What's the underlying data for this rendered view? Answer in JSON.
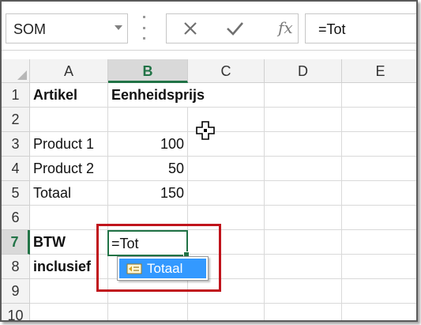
{
  "formula_bar": {
    "name_box": "SOM",
    "cancel_icon": "close-icon",
    "enter_icon": "checkmark-icon",
    "function_label": "fx",
    "formula": "=Tot"
  },
  "columns": [
    "A",
    "B",
    "C",
    "D",
    "E"
  ],
  "selected_column": "B",
  "rows": [
    "1",
    "2",
    "3",
    "4",
    "5",
    "6",
    "7",
    "8",
    "9",
    "10"
  ],
  "selected_row": "7",
  "cells": {
    "A1": "Artikel",
    "B1": "Eenheidsprijs",
    "A3": "Product 1",
    "B3": "100",
    "A4": "Product 2",
    "B4": "50",
    "A5": "Totaal",
    "B5": "150",
    "A7": "BTW",
    "A8": "inclusief"
  },
  "active_cell": {
    "ref": "B7",
    "value": "=Tot"
  },
  "autocomplete": {
    "items": [
      {
        "label": "Totaal",
        "icon": "named-range-icon"
      }
    ]
  },
  "colors": {
    "accent": "#217346",
    "highlight": "#c0141c",
    "selection": "#3399ff"
  }
}
